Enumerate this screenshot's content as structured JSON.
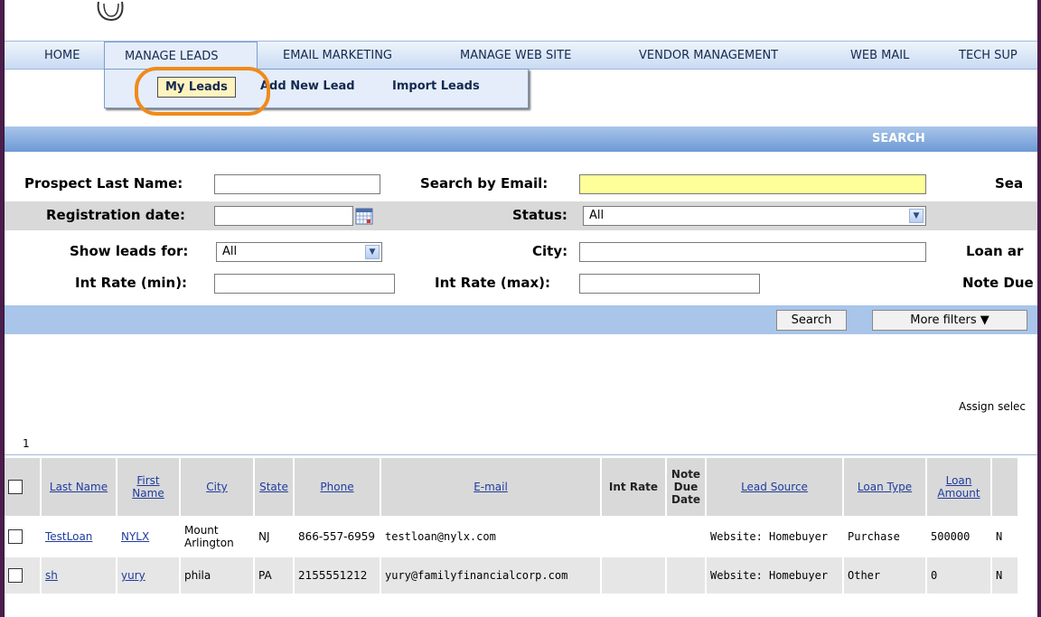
{
  "nav": {
    "items": [
      "HOME",
      "MANAGE LEADS",
      "EMAIL MARKETING",
      "MANAGE WEB SITE",
      "VENDOR MANAGEMENT",
      "WEB MAIL",
      "TECH SUP"
    ]
  },
  "submenu": {
    "items": [
      "My Leads",
      "Add New Lead",
      "Import Leads"
    ]
  },
  "search_bar": {
    "title": "SEARCH"
  },
  "filters": {
    "last_name_label": "Prospect Last Name:",
    "email_label": "Search by Email:",
    "search_label_cut": "Sea",
    "reg_date_label": "Registration date:",
    "status_label": "Status:",
    "status_value": "All",
    "show_leads_label": "Show leads for:",
    "show_leads_value": "All",
    "city_label": "City:",
    "loan_label_cut": "Loan ar",
    "int_min_label": "Int Rate (min):",
    "int_max_label": "Int Rate (max):",
    "note_due_label_cut": "Note Due"
  },
  "actions": {
    "search": "Search",
    "more_filters": "More filters ▼"
  },
  "pager": "1",
  "assign_text": "Assign selec",
  "table": {
    "headers": [
      "Last Name",
      "First Name",
      "City",
      "State",
      "Phone",
      "E-mail",
      "Int Rate",
      "Note Due Date",
      "Lead Source",
      "Loan Type",
      "Loan Amount"
    ],
    "rows": [
      {
        "last": "TestLoan",
        "first": "NYLX",
        "city": "Mount Arlington",
        "state": "NJ",
        "phone": "866-557-6959",
        "email": "testloan@nylx.com",
        "rate": "",
        "due": "",
        "source": "Website: Homebuyer",
        "type": "Purchase",
        "amount": "500000",
        "extra": "N"
      },
      {
        "last": "sh",
        "first": "yury",
        "city": "phila",
        "state": "PA",
        "phone": "2155551212",
        "email": "yury@familyfinancialcorp.com",
        "rate": "",
        "due": "",
        "source": "Website: Homebuyer",
        "type": "Other",
        "amount": "0",
        "extra": "N"
      }
    ]
  }
}
